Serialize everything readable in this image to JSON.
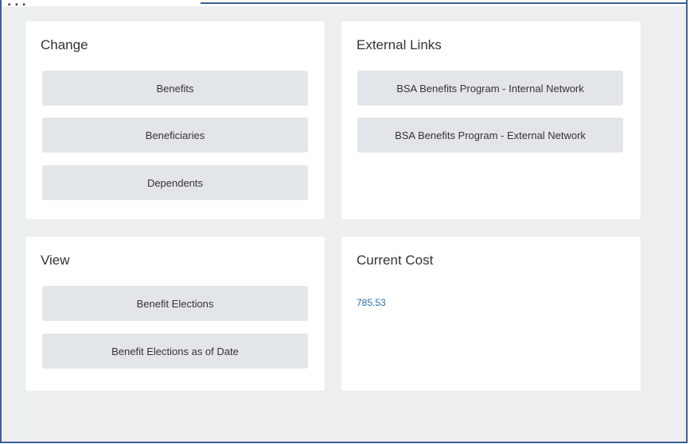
{
  "header": {
    "partial_title": "..."
  },
  "change": {
    "title": "Change",
    "buttons": [
      "Benefits",
      "Beneficiaries",
      "Dependents"
    ]
  },
  "external_links": {
    "title": "External Links",
    "links": [
      "BSA Benefits Program - Internal Network",
      "BSA Benefits Program - External Network"
    ]
  },
  "view": {
    "title": "View",
    "buttons": [
      "Benefit Elections",
      "Benefit Elections as of Date"
    ]
  },
  "current_cost": {
    "title": "Current Cost",
    "value": "785.53"
  },
  "colors": {
    "background": "#edeef0",
    "card": "#ffffff",
    "button": "#e3e6e9",
    "link": "#2a6fad",
    "frame_border": "#3a5f96"
  }
}
